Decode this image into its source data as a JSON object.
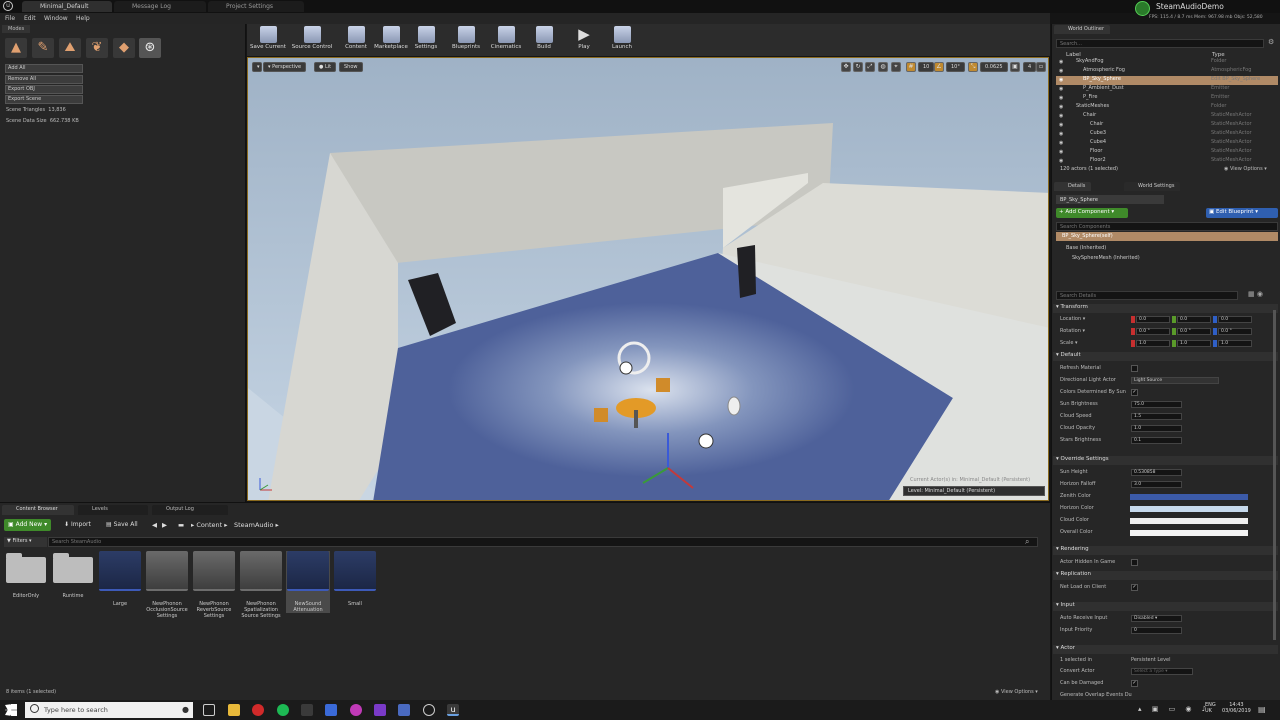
{
  "tabs": [
    {
      "label": "Minimal_Default"
    },
    {
      "label": "Message Log"
    },
    {
      "label": "Project Settings"
    }
  ],
  "menu": [
    "File",
    "Edit",
    "Window",
    "Help"
  ],
  "stats": {
    "project": "SteamAudioDemo",
    "fps": "FPS: 115.4 / 8.7 ms",
    "mem": "Mem: 967.98 mb",
    "objs": "Objs: 52,580"
  },
  "modes_panel": {
    "tab": "Modes",
    "buttons": [
      "Add All",
      "Remove All",
      "Export OBJ",
      "Export Scene"
    ],
    "scene_triangles_label": "Scene Triangles",
    "scene_triangles_value": "13,836",
    "scene_size_label": "Scene Data Size",
    "scene_size_value": "662.738 KB"
  },
  "toolbar": [
    {
      "label": "Save Current"
    },
    {
      "label": "Source Control"
    },
    {
      "label": "Content"
    },
    {
      "label": "Marketplace"
    },
    {
      "label": "Settings"
    },
    {
      "label": "Blueprints"
    },
    {
      "label": "Cinematics"
    },
    {
      "label": "Build"
    },
    {
      "label": "Play"
    },
    {
      "label": "Launch"
    }
  ],
  "viewport": {
    "perspective": "Perspective",
    "lit": "Lit",
    "show": "Show",
    "grid_snap": "10",
    "rot_snap": "10°",
    "scale_snap": "0.0625",
    "cam_speed": "4",
    "level": "Level: Minimal_Default (Persistent)",
    "ghost": "Current Actor(s) in: Minimal_Default (Persistent)"
  },
  "content_browser": {
    "tabs": [
      "Content Browser",
      "Levels",
      "Output Log"
    ],
    "add_new": "Add New",
    "import": "Import",
    "save_all": "Save All",
    "path": [
      "Content",
      "SteamAudio"
    ],
    "filters": "Filters",
    "search_placeholder": "Search SteamAudio",
    "assets": [
      {
        "name": "EditorOnly",
        "kind": "folder"
      },
      {
        "name": "Runtime",
        "kind": "folder"
      },
      {
        "name": "Large",
        "kind": "sound"
      },
      {
        "name": "NewPhonon OcclusionSource Settings",
        "kind": "setting"
      },
      {
        "name": "NewPhonon ReverbSource Settings",
        "kind": "setting"
      },
      {
        "name": "NewPhonon Spatialization Source Settings",
        "kind": "setting"
      },
      {
        "name": "NewSound Attenuation",
        "kind": "sound"
      },
      {
        "name": "Small",
        "kind": "sound"
      }
    ],
    "footer": "8 items (1 selected)",
    "view_options": "View Options"
  },
  "outliner": {
    "tab": "World Outliner",
    "search_placeholder": "Search...",
    "col_label": "Label",
    "col_type": "Type",
    "rows": [
      {
        "label": "SkyAndFog",
        "type": "Folder",
        "indent": 2
      },
      {
        "label": "Atmospheric Fog",
        "type": "AtmosphericFog",
        "indent": 3
      },
      {
        "label": "BP_Sky_Sphere",
        "type": "Edit BP_Sky_Sphere",
        "indent": 3,
        "selected": true
      },
      {
        "label": "P_Ambient_Dust",
        "type": "Emitter",
        "indent": 3
      },
      {
        "label": "P_Fire",
        "type": "Emitter",
        "indent": 3
      },
      {
        "label": "StaticMeshes",
        "type": "Folder",
        "indent": 2
      },
      {
        "label": "Chair",
        "type": "StaticMeshActor",
        "indent": 3
      },
      {
        "label": "Chair",
        "type": "StaticMeshActor",
        "indent": 4
      },
      {
        "label": "Cube3",
        "type": "StaticMeshActor",
        "indent": 4
      },
      {
        "label": "Cube4",
        "type": "StaticMeshActor",
        "indent": 4
      },
      {
        "label": "Floor",
        "type": "StaticMeshActor",
        "indent": 4
      },
      {
        "label": "Floor2",
        "type": "StaticMeshActor",
        "indent": 4
      }
    ],
    "footer": "120 actors (1 selected)",
    "view_options": "View Options"
  },
  "details": {
    "tabs": [
      "Details",
      "World Settings"
    ],
    "actor_name": "BP_Sky_Sphere",
    "add_component": "Add Component",
    "edit_blueprint": "Edit Blueprint",
    "search_components": "Search Components",
    "components": [
      "BP_Sky_Sphere(self)",
      "Base (Inherited)",
      "SkySphereMesh (Inherited)"
    ],
    "search_details": "Search Details",
    "transform": {
      "title": "Transform",
      "location_label": "Location",
      "location": [
        "0.0",
        "0.0",
        "0.0"
      ],
      "rotation_label": "Rotation",
      "rotation": [
        "0.0 °",
        "0.0 °",
        "0.0 °"
      ],
      "scale_label": "Scale",
      "scale": [
        "1.0",
        "1.0",
        "1.0"
      ]
    },
    "default_section": {
      "title": "Default",
      "props": [
        {
          "label": "Refresh Material",
          "kind": "check",
          "value": ""
        },
        {
          "label": "Directional Light Actor",
          "kind": "dropdown",
          "value": "Light Source"
        },
        {
          "label": "Colors Determined By Sun",
          "kind": "check",
          "value": "✓"
        },
        {
          "label": "Sun Brightness",
          "kind": "num",
          "value": "75.0"
        },
        {
          "label": "Cloud Speed",
          "kind": "num",
          "value": "1.5"
        },
        {
          "label": "Cloud Opacity",
          "kind": "num",
          "value": "1.0"
        },
        {
          "label": "Stars Brightness",
          "kind": "num",
          "value": "0.1"
        }
      ]
    },
    "override_section": {
      "title": "Override Settings",
      "props": [
        {
          "label": "Sun Height",
          "value": "0.530858"
        },
        {
          "label": "Horizon Falloff",
          "value": "3.0"
        },
        {
          "label": "Zenith Color",
          "color": "#3b5aa8"
        },
        {
          "label": "Horizon Color",
          "color": "#c6d9ec"
        },
        {
          "label": "Cloud Color",
          "color": "#eeeeee"
        },
        {
          "label": "Overall Color",
          "color": "#f4f4f4"
        }
      ]
    },
    "rendering": {
      "title": "Rendering",
      "prop": "Actor Hidden In Game"
    },
    "replication": {
      "title": "Replication",
      "prop": "Net Load on Client"
    },
    "input": {
      "title": "Input",
      "auto_label": "Auto Receive Input",
      "auto_value": "Disabled",
      "priority_label": "Input Priority",
      "priority_value": "0"
    },
    "actor": {
      "title": "Actor",
      "selected_in_label": "1 selected in",
      "selected_in_value": "Persistent Level",
      "convert_label": "Convert Actor",
      "convert_value": "Select a Type",
      "damaged_label": "Can be Damaged",
      "overlap_label": "Generate Overlap Events Du"
    }
  },
  "taskbar": {
    "search_placeholder": "Type here to search",
    "lang": "ENG",
    "region": "UK",
    "time": "14:43",
    "date": "03/06/2019"
  }
}
